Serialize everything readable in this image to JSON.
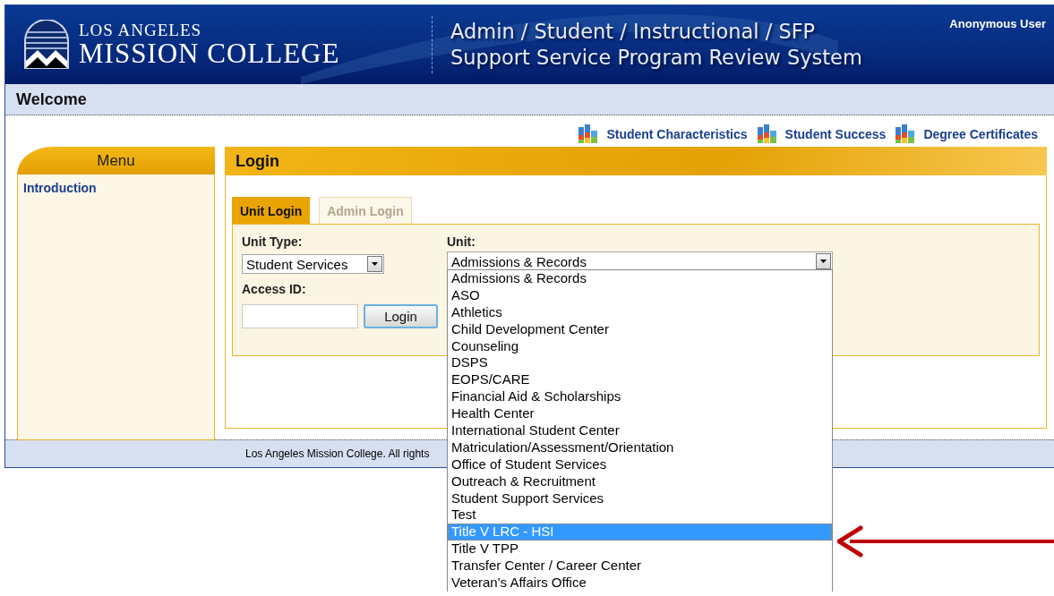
{
  "header": {
    "logo_line1": "LOS ANGELES",
    "logo_line2": "MISSION COLLEGE",
    "title_line1": "Admin / Student / Instructional / SFP",
    "title_line2": "Support Service Program Review System",
    "user": "Anonymous User"
  },
  "page_title": "Welcome",
  "report_links": [
    "Student Characteristics",
    "Student Success",
    "Degree Certificates"
  ],
  "menu": {
    "title": "Menu",
    "items": [
      "Introduction"
    ]
  },
  "login": {
    "title": "Login",
    "tabs": [
      {
        "label": "Unit Login",
        "selected": true
      },
      {
        "label": "Admin Login",
        "selected": false
      }
    ],
    "unit_type_label": "Unit Type:",
    "unit_type_value": "Student Services",
    "access_id_label": "Access ID:",
    "login_button": "Login",
    "unit_label": "Unit:",
    "unit_value": "Admissions & Records",
    "unit_options": [
      {
        "label": "Admissions & Records",
        "selected": false
      },
      {
        "label": "ASO",
        "selected": false
      },
      {
        "label": "Athletics",
        "selected": false
      },
      {
        "label": "Child Development Center",
        "selected": false
      },
      {
        "label": "Counseling",
        "selected": false
      },
      {
        "label": "DSPS",
        "selected": false
      },
      {
        "label": "EOPS/CARE",
        "selected": false
      },
      {
        "label": "Financial Aid & Scholarships",
        "selected": false
      },
      {
        "label": "Health Center",
        "selected": false
      },
      {
        "label": "International Student Center",
        "selected": false
      },
      {
        "label": "Matriculation/Assessment/Orientation",
        "selected": false
      },
      {
        "label": "Office of Student Services",
        "selected": false
      },
      {
        "label": "Outreach & Recruitment",
        "selected": false
      },
      {
        "label": "Student Support Services",
        "selected": false
      },
      {
        "label": "Test",
        "selected": false
      },
      {
        "label": "Title V LRC - HSI",
        "selected": true
      },
      {
        "label": "Title V TPP",
        "selected": false
      },
      {
        "label": "Transfer Center / Career Center",
        "selected": false
      },
      {
        "label": "Veteran's Affairs Office",
        "selected": false
      }
    ]
  },
  "footer": "Los Angeles Mission College. All rights"
}
